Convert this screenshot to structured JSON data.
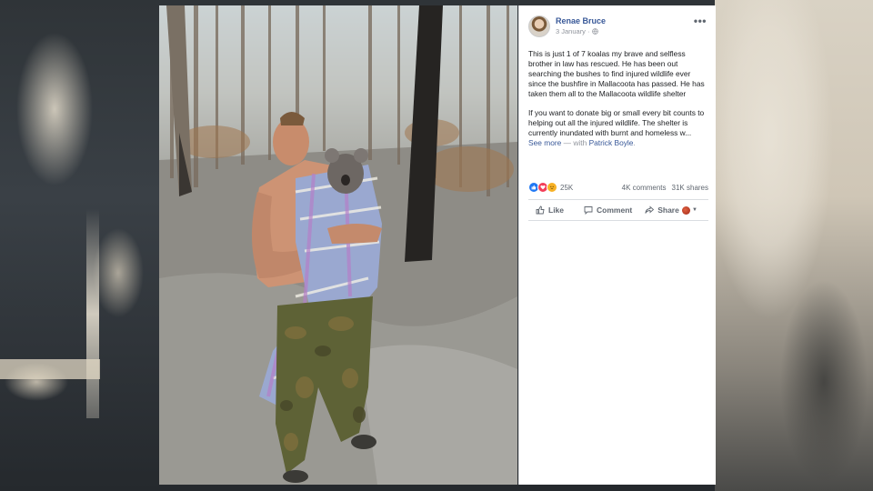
{
  "post": {
    "author": "Renae Bruce",
    "date": "3 January ·",
    "paragraph1": "This is just 1 of 7 koalas my brave and selfless brother in law has rescued. He has been out searching the bushes to find injured wildlife ever since the bushfire in Mallacoota has passed. He has taken them all to the Mallacoota wildlife shelter",
    "paragraph2": "If you want to donate big or small every bit counts to helping out all the injured wildlife. The shelter is currently inundated with burnt and homeless w...",
    "see_more": "See more",
    "with_text": " — with ",
    "tagged": "Patrick Boyle",
    "tagged_suffix": "."
  },
  "stats": {
    "reactions_count": "25K",
    "comments": "4K comments",
    "shares": "31K shares"
  },
  "actions": {
    "like": "Like",
    "comment": "Comment",
    "share": "Share"
  },
  "icons": {
    "more": "•••",
    "caret": "▼"
  },
  "colors": {
    "link": "#385898",
    "like": "#2078f4",
    "love": "#f33e58",
    "sad": "#f7b125"
  }
}
